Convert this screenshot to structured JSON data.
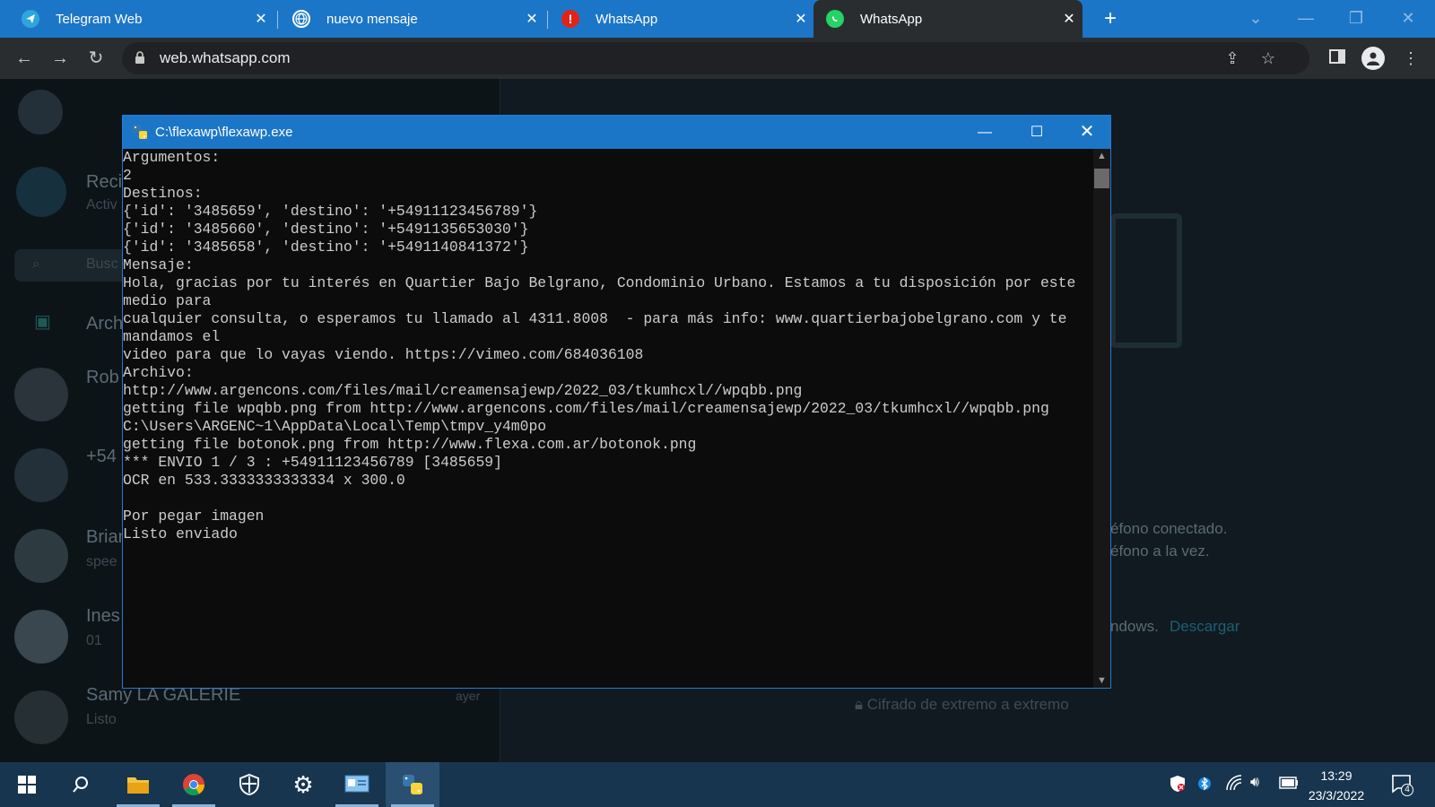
{
  "browser": {
    "tabs": [
      {
        "title": "Telegram Web",
        "icon": "telegram-icon",
        "color": "#2ea6dc"
      },
      {
        "title": "nuevo mensaje",
        "icon": "globe-icon",
        "color": "#ffffff"
      },
      {
        "title": "WhatsApp",
        "icon": "alert-icon",
        "color": "#e2231a"
      },
      {
        "title": "WhatsApp",
        "icon": "whatsapp-icon",
        "color": "#25d366"
      }
    ],
    "url": "web.whatsapp.com"
  },
  "whatsapp": {
    "sidebar": [
      {
        "name": "Reci",
        "sub": "Activ"
      },
      {
        "name": "Busc",
        "sub": ""
      },
      {
        "name": "Arch",
        "sub": ""
      },
      {
        "name": "Rob",
        "sub": ""
      },
      {
        "name": "+54",
        "sub": ""
      },
      {
        "name": "Brian",
        "sub": "spee"
      },
      {
        "name": "Ines",
        "sub": "01"
      },
      {
        "name": "Samy LA GALERIE",
        "sub": "Listo",
        "time": "ayer"
      }
    ],
    "main": {
      "line1": "éfono conectado.",
      "line2": "éfono a la vez.",
      "line3": "ndows.",
      "download": "Descargar",
      "encrypted": "Cifrado de extremo a extremo"
    }
  },
  "console": {
    "title": "C:\\flexawp\\flexawp.exe",
    "lines": [
      "Argumentos:",
      "2",
      "Destinos:",
      "{'id': '3485659', 'destino': '+54911123456789'}",
      "{'id': '3485660', 'destino': '+5491135653030'}",
      "{'id': '3485658', 'destino': '+5491140841372'}",
      "Mensaje:",
      "Hola, gracias por tu interés en Quartier Bajo Belgrano, Condominio Urbano. Estamos a tu disposición por este medio para",
      "cualquier consulta, o esperamos tu llamado al 4311.8008  - para más info: www.quartierbajobelgrano.com y te mandamos el",
      "video para que lo vayas viendo. https://vimeo.com/684036108",
      "Archivo:",
      "http://www.argencons.com/files/mail/creamensajewp/2022_03/tkumhcxl//wpqbb.png",
      "getting file wpqbb.png from http://www.argencons.com/files/mail/creamensajewp/2022_03/tkumhcxl//wpqbb.png",
      "C:\\Users\\ARGENC~1\\AppData\\Local\\Temp\\tmpv_y4m0po",
      "getting file botonok.png from http://www.flexa.com.ar/botonok.png",
      "*** ENVIO 1 / 3 : +54911123456789 [3485659]",
      "OCR en 533.3333333333334 x 300.0",
      "",
      "Por pegar imagen",
      "Listo enviado"
    ]
  },
  "taskbar": {
    "time": "13:29",
    "date": "23/3/2022",
    "notifications": "4"
  }
}
